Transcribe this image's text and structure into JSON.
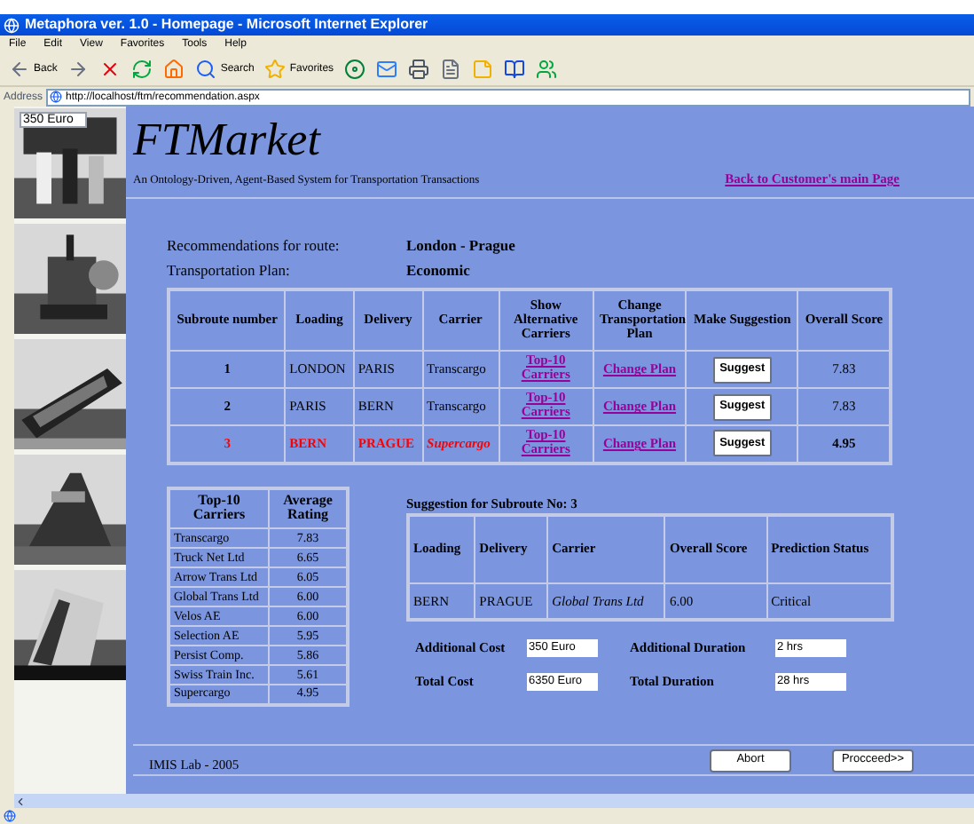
{
  "window": {
    "title": "Metaphora ver. 1.0 - Homepage - Microsoft Internet Explorer"
  },
  "menu": [
    "File",
    "Edit",
    "View",
    "Favorites",
    "Tools",
    "Help"
  ],
  "toolbar": [
    {
      "kind": "back",
      "label": "Back"
    },
    {
      "kind": "forward"
    },
    {
      "kind": "stop"
    },
    {
      "kind": "refresh"
    },
    {
      "kind": "home"
    },
    {
      "kind": "search",
      "label": "Search"
    },
    {
      "kind": "favorites",
      "label": "Favorites"
    },
    {
      "kind": "media"
    },
    {
      "kind": "mail"
    },
    {
      "kind": "print"
    },
    {
      "kind": "edit"
    },
    {
      "kind": "note"
    },
    {
      "kind": "research"
    },
    {
      "kind": "messenger"
    }
  ],
  "address": {
    "label": "Address",
    "url": "http://localhost/ftm/recommendation.aspx"
  },
  "sidebar": {
    "overlay_field": "350 Euro"
  },
  "header": {
    "title": "FTMarket",
    "subtitle": "An Ontology-Driven, Agent-Based System for Transportation Transactions",
    "back_link": "Back to Customer's main Page"
  },
  "route": {
    "label": "Recommendations for route:",
    "value": "London - Prague"
  },
  "plan": {
    "label": "Transportation Plan:",
    "value": "Economic"
  },
  "subroutes": {
    "columns": [
      "Subroute number",
      "Loading",
      "Delivery",
      "Carrier",
      "Show Alternative Carriers",
      "Change Transportation Plan",
      "Make Suggestion",
      "Overall Score"
    ],
    "rows": [
      {
        "number": "1",
        "loading": "LONDON",
        "delivery": "PARIS",
        "carrier": "Transcargo",
        "alternatives_link": "Top-10 Carriers",
        "change_link": "Change Plan",
        "suggest_button": "Suggest",
        "score": "7.83",
        "critical": false
      },
      {
        "number": "2",
        "loading": "PARIS",
        "delivery": "BERN",
        "carrier": "Transcargo",
        "alternatives_link": "Top-10 Carriers",
        "change_link": "Change Plan",
        "suggest_button": "Suggest",
        "score": "7.83",
        "critical": false
      },
      {
        "number": "3",
        "loading": "BERN",
        "delivery": "PRAGUE",
        "carrier": "Supercargo",
        "alternatives_link": "Top-10 Carriers",
        "change_link": "Change Plan",
        "suggest_button": "Suggest",
        "score": "4.95",
        "critical": true
      }
    ]
  },
  "top_carriers": {
    "columns": [
      "Top-10 Carriers",
      "Average Rating"
    ],
    "rows": [
      {
        "carrier": "Transcargo",
        "rating": "7.83"
      },
      {
        "carrier": "Truck Net Ltd",
        "rating": "6.65"
      },
      {
        "carrier": "Arrow Trans Ltd",
        "rating": "6.05"
      },
      {
        "carrier": "Global Trans Ltd",
        "rating": "6.00"
      },
      {
        "carrier": "Velos AE",
        "rating": "6.00"
      },
      {
        "carrier": "Selection AE",
        "rating": "5.95"
      },
      {
        "carrier": "Persist Comp.",
        "rating": "5.86"
      },
      {
        "carrier": "Swiss Train Inc.",
        "rating": "5.61"
      },
      {
        "carrier": "Supercargo",
        "rating": "4.95"
      }
    ]
  },
  "suggestion": {
    "title": "Suggestion for Subroute No: 3",
    "columns": [
      "Loading",
      "Delivery",
      "Carrier",
      "Overall Score",
      "Prediction Status"
    ],
    "row": {
      "loading": "BERN",
      "delivery": "PRAGUE",
      "carrier": "Global Trans Ltd",
      "score": "6.00",
      "status": "Critical"
    },
    "fields": [
      {
        "label": "Additional Cost",
        "value": "350 Euro"
      },
      {
        "label": "Additional Duration",
        "value": "2 hrs"
      },
      {
        "label": "Total Cost",
        "value": "6350 Euro"
      },
      {
        "label": "Total Duration",
        "value": "28 hrs"
      }
    ]
  },
  "footer": {
    "text": "IMIS Lab - 2005",
    "buttons": [
      "Abort",
      "Procceed>>"
    ]
  }
}
